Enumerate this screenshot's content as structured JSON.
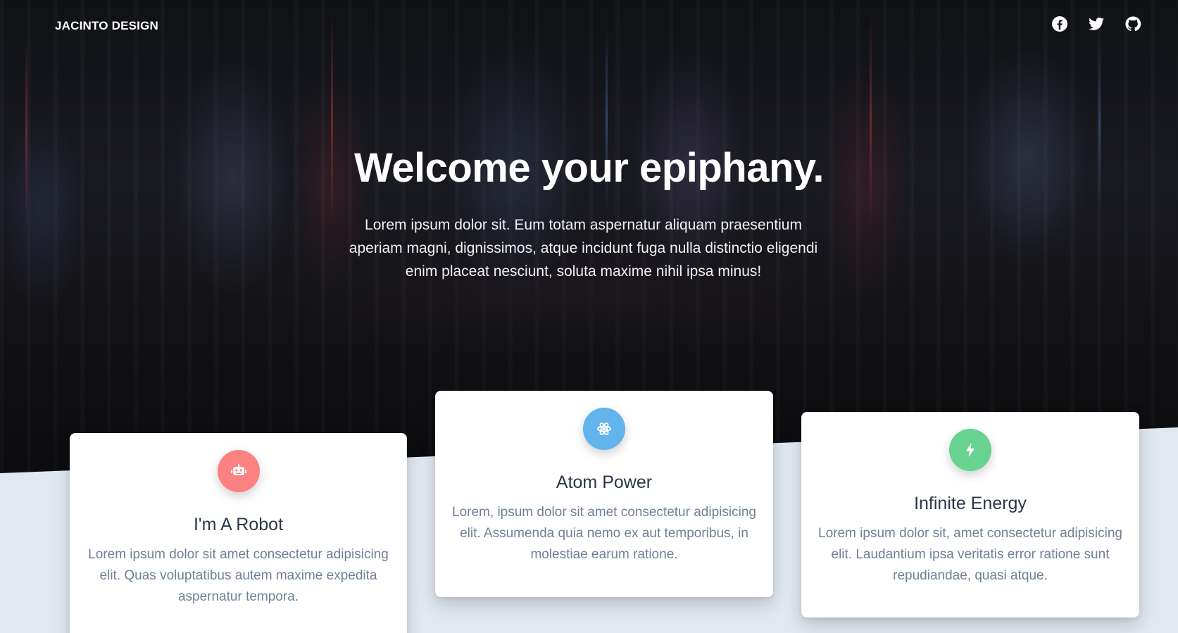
{
  "nav": {
    "brand": "JACINTO DESIGN",
    "social": [
      "facebook-icon",
      "twitter-icon",
      "github-icon"
    ]
  },
  "hero": {
    "title": "Welcome your epiphany.",
    "subtitle": "Lorem ipsum dolor sit. Eum totam aspernatur aliquam praesentium aperiam magni, dignissimos, atque incidunt fuga nulla distinctio eligendi enim placeat nesciunt, soluta maxime nihil ipsa minus!"
  },
  "colors": {
    "robot_badge": "#fc8181",
    "atom_badge": "#63b3ed",
    "energy_badge": "#68d391",
    "section_bg": "#e2e8f0"
  },
  "cards": [
    {
      "icon": "robot-icon",
      "title": "I'm A Robot",
      "body": "Lorem ipsum dolor sit amet consectetur adipisicing elit. Quas voluptatibus autem maxime expedita aspernatur tempora."
    },
    {
      "icon": "atom-icon",
      "title": "Atom Power",
      "body": "Lorem, ipsum dolor sit amet consectetur adipisicing elit. Assumenda quia nemo ex aut temporibus, in molestiae earum ratione."
    },
    {
      "icon": "bolt-icon",
      "title": "Infinite Energy",
      "body": "Lorem ipsum dolor sit, amet consectetur adipisicing elit. Laudantium ipsa veritatis error ratione sunt repudiandae, quasi atque."
    }
  ]
}
